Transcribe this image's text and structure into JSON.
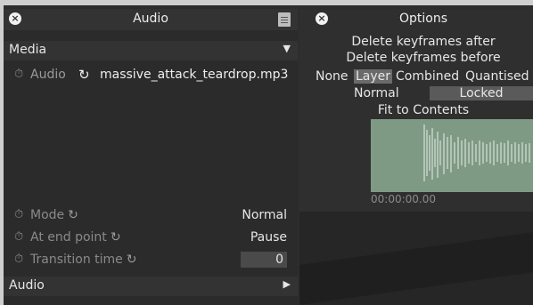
{
  "left_panel": {
    "title": "Audio",
    "media_header": "Media",
    "audio_row": {
      "label": "Audio",
      "file": "massive_attack_teardrop.mp3"
    },
    "mode": {
      "label": "Mode",
      "value": "Normal"
    },
    "end_point": {
      "label": "At end point",
      "value": "Pause"
    },
    "transition": {
      "label": "Transition time",
      "value": "0"
    },
    "bottom_header": "Audio"
  },
  "right_panel": {
    "title": "Options",
    "menu": [
      "Delete keyframes after",
      "Delete keyframes before"
    ],
    "modes": [
      "None",
      "Layer",
      "Combined",
      "Quantised"
    ],
    "blend_left": "Normal",
    "blend_right": "Locked",
    "fit_label": "Fit to Contents",
    "timecode": "00:00:00.00"
  },
  "icons": {
    "close": "close-icon",
    "document": "document-icon",
    "dropdown": "triangle-down-icon",
    "expand": "triangle-right-icon",
    "reset": "reset-icon",
    "clock": "stopwatch-icon"
  }
}
